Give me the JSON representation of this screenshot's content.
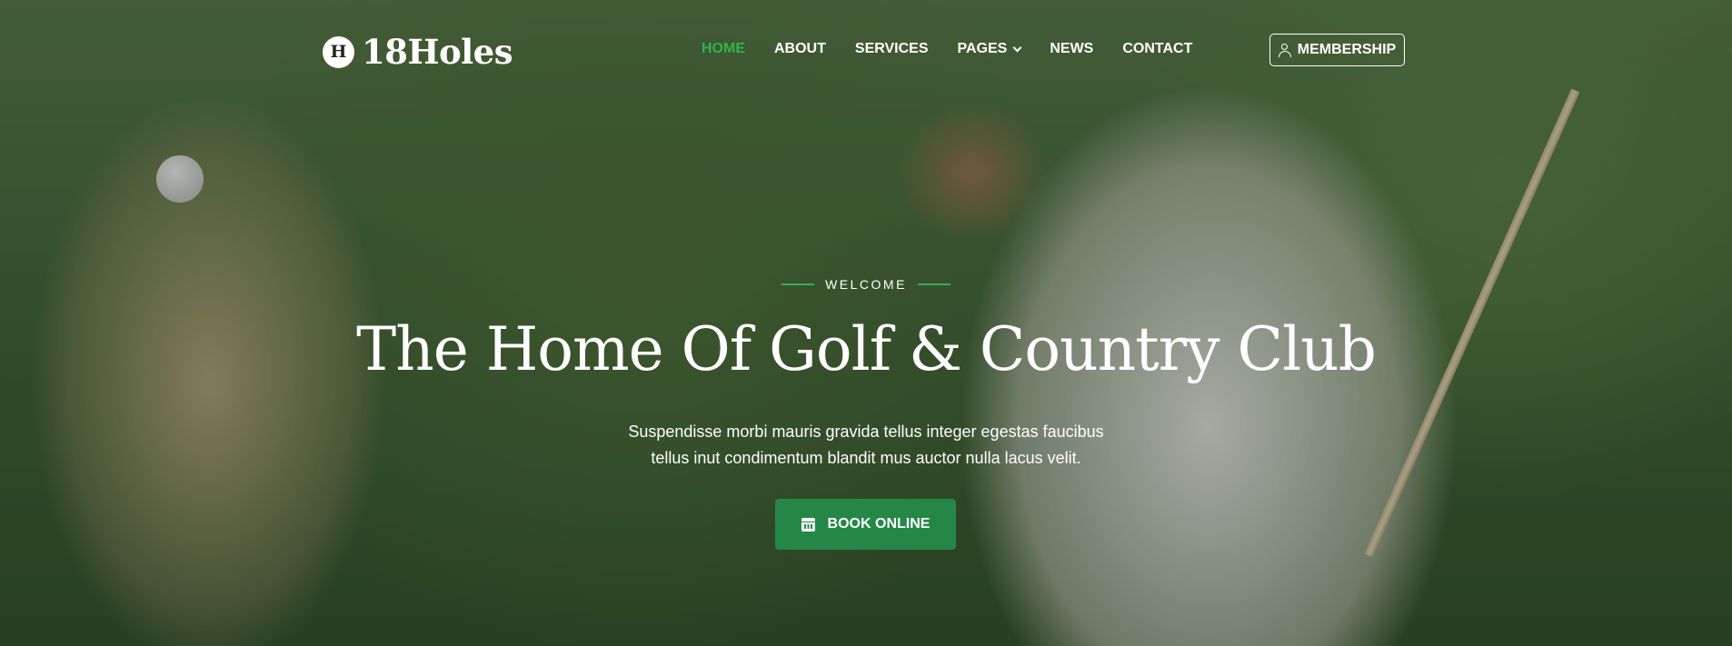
{
  "brand": {
    "badge_letter": "H",
    "name": "18Holes"
  },
  "nav": {
    "items": [
      {
        "label": "HOME",
        "active": true
      },
      {
        "label": "ABOUT"
      },
      {
        "label": "SERVICES"
      },
      {
        "label": "PAGES",
        "has_dropdown": true
      },
      {
        "label": "NEWS"
      },
      {
        "label": "CONTACT"
      }
    ],
    "membership_label": "MEMBERSHIP",
    "membership_icon": "user-icon"
  },
  "hero": {
    "eyebrow": "WELCOME",
    "title": "The Home Of Golf & Country Club",
    "subtitle_line1": "Suspendisse morbi mauris gravida tellus integer egestas faucibus",
    "subtitle_line2": "tellus inut condimentum blandit mus auctor nulla lacus velit.",
    "cta_label": "BOOK ONLINE",
    "cta_icon": "calendar-icon"
  },
  "colors": {
    "accent": "#2fb34a",
    "button_bg": "#258747",
    "text": "#ffffff"
  }
}
